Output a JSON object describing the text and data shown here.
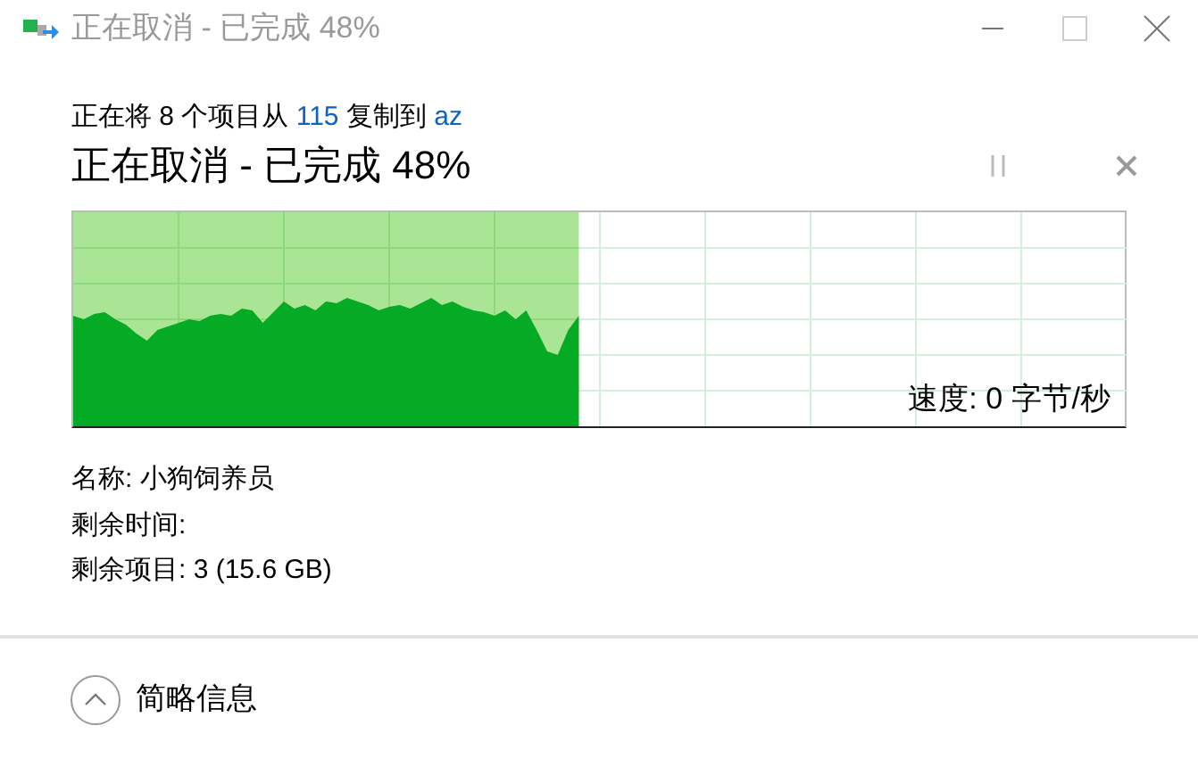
{
  "window": {
    "title": "正在取消 - 已完成 48%"
  },
  "header": {
    "prefix": "正在将 8 个项目从",
    "source": "115",
    "middle": "复制到",
    "destination": "az"
  },
  "status": "正在取消 - 已完成 48%",
  "progress": {
    "level": 0.48,
    "speed": "速度: 0 字节/秒"
  },
  "details": [
    "名称: 小狗饲养员",
    "剩余时间:",
    "剩余项目: 3 (15.6 GB)"
  ],
  "footer": {
    "toggle": "简略信息",
    "expanded": true
  }
}
